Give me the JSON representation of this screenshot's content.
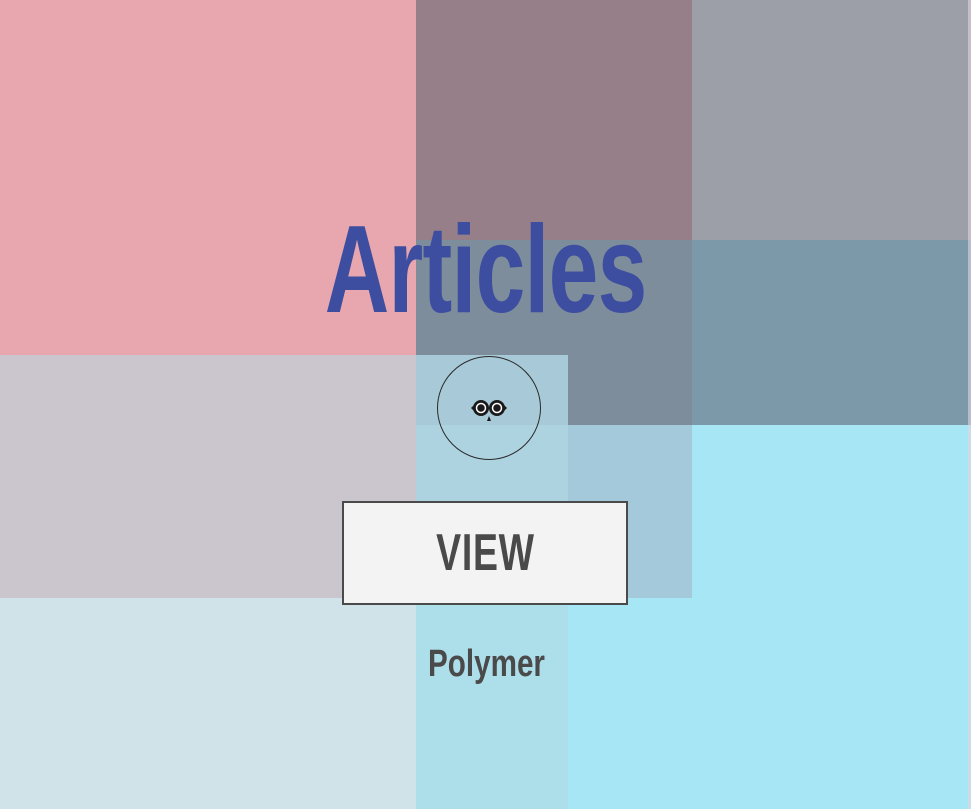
{
  "page": {
    "title": "Articles",
    "logo_icon": "owl-eyes-icon",
    "view_button_label": "VIEW",
    "footer_label": "Polymer"
  },
  "colors": {
    "title": "#3d4ea0",
    "button_text": "#4a4a4a",
    "button_bg": "#f3f3f3",
    "tile_pink": "#e8a6ae",
    "tile_mauve": "#967f89",
    "tile_grey": "#9c9ea8",
    "tile_slate_blue": "#7c99aa",
    "tile_lilac_grey": "#cbc6cd",
    "tile_light_blue": "#a4c9da",
    "tile_cyan": "#a7e7f5",
    "tile_pale_blue": "#cfe3e9"
  }
}
